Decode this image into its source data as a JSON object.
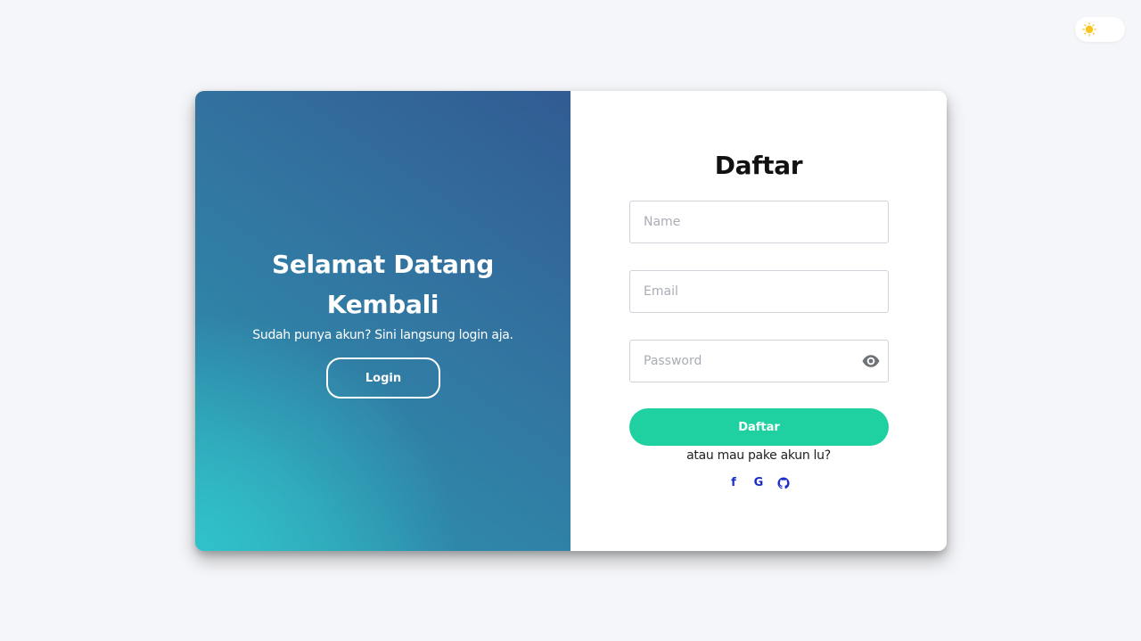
{
  "theme_toggle": {
    "icon": "sun-icon",
    "accent": "#f7c51e"
  },
  "left_panel": {
    "title_line1": "Selamat Datang",
    "title_line2": "Kembali",
    "subtitle": "Sudah punya akun? Sini langsung login aja.",
    "login_button": "Login"
  },
  "form": {
    "title": "Daftar",
    "name_placeholder": "Name",
    "email_placeholder": "Email",
    "password_placeholder": "Password",
    "password_toggle_icon": "eye-icon",
    "submit_label": "Daftar",
    "alt_text": "atau mau pake akun lu?",
    "socials": [
      {
        "icon": "facebook-icon",
        "glyph": "f"
      },
      {
        "icon": "google-icon",
        "glyph": "G"
      },
      {
        "icon": "github-icon"
      }
    ]
  },
  "colors": {
    "page_background": "#f5f6f9",
    "panel_gradient_start": "#2fbfca",
    "panel_gradient_end": "#315b92",
    "submit_button": "#1fd1a0",
    "social_icons": "#1a2ccc"
  }
}
